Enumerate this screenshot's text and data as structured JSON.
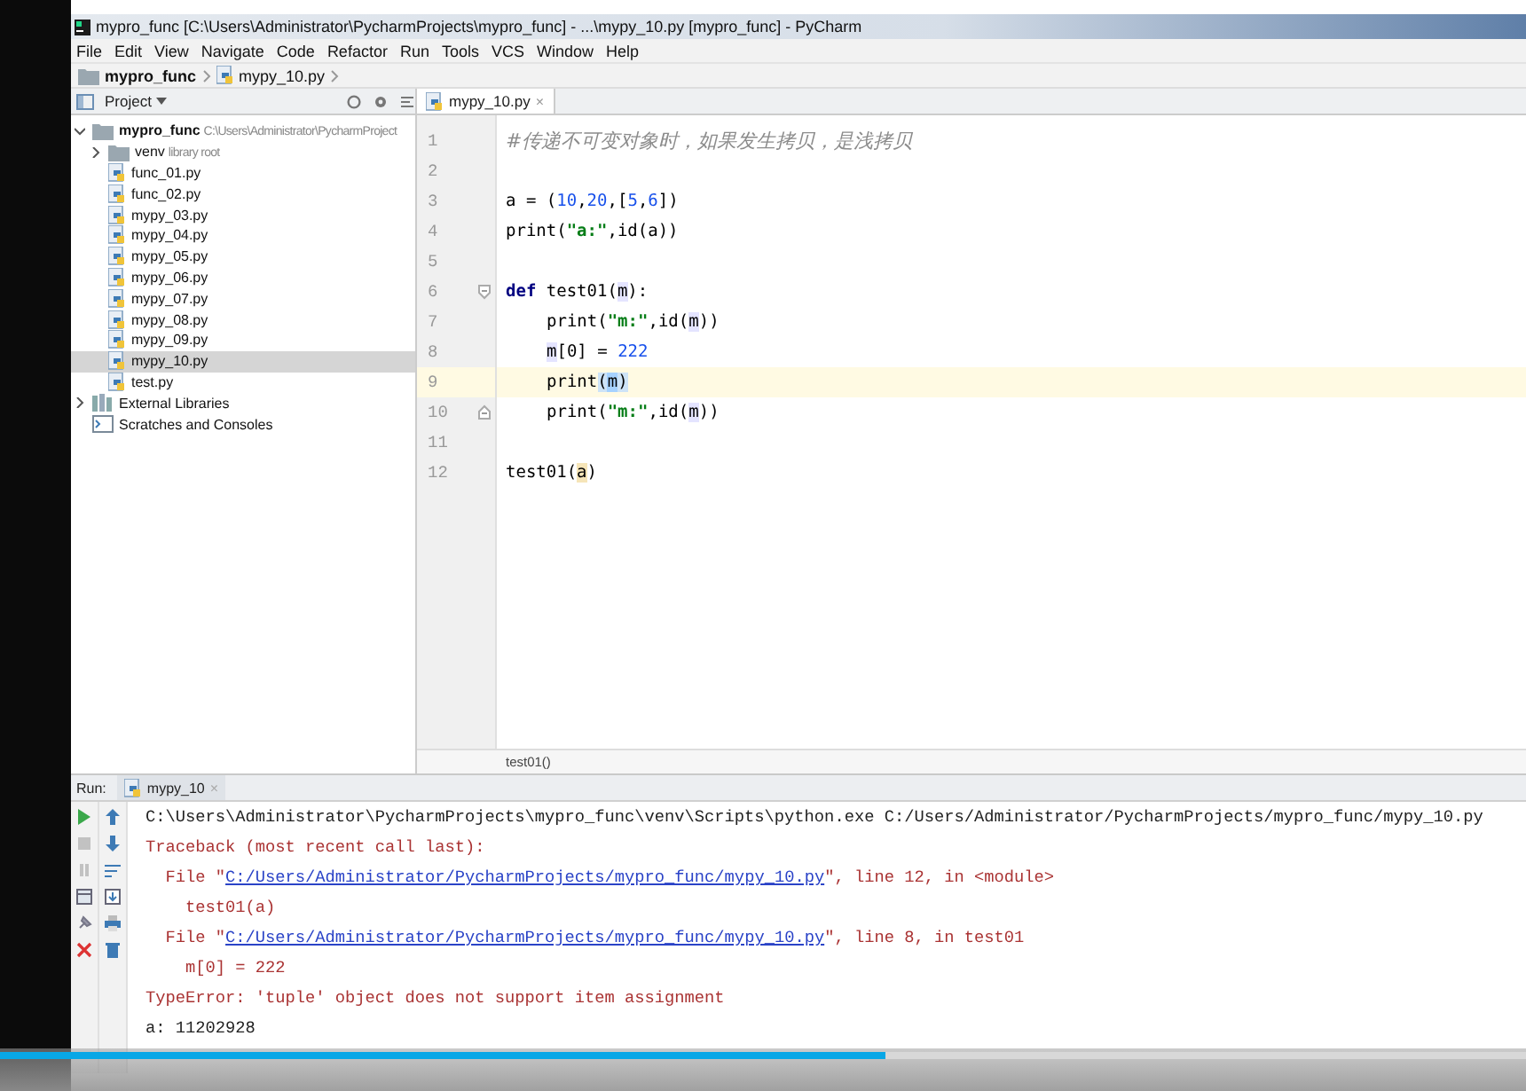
{
  "window": {
    "title": "mypro_func [C:\\Users\\Administrator\\PycharmProjects\\mypro_func] - ...\\mypy_10.py [mypro_func] - PyCharm"
  },
  "menu": [
    "File",
    "Edit",
    "View",
    "Navigate",
    "Code",
    "Refactor",
    "Run",
    "Tools",
    "VCS",
    "Window",
    "Help"
  ],
  "breadcrumb": [
    {
      "kind": "folder",
      "label": "mypro_func"
    },
    {
      "kind": "file",
      "label": "mypy_10.py"
    }
  ],
  "project_panel": {
    "title": "Project",
    "tree": [
      {
        "label": "mypro_func",
        "hint": "C:\\Users\\Administrator\\PycharmProject",
        "kind": "folder",
        "expanded": true,
        "selected": false,
        "children": [
          {
            "label": "venv",
            "hint": "library root",
            "kind": "folder",
            "expanded": false,
            "selected": false
          },
          {
            "label": "func_01.py",
            "kind": "file",
            "selected": false
          },
          {
            "label": "func_02.py",
            "kind": "file",
            "selected": false
          },
          {
            "label": "mypy_03.py",
            "kind": "file",
            "selected": false
          },
          {
            "label": "mypy_04.py",
            "kind": "file",
            "selected": false
          },
          {
            "label": "mypy_05.py",
            "kind": "file",
            "selected": false
          },
          {
            "label": "mypy_06.py",
            "kind": "file",
            "selected": false
          },
          {
            "label": "mypy_07.py",
            "kind": "file",
            "selected": false
          },
          {
            "label": "mypy_08.py",
            "kind": "file",
            "selected": false
          },
          {
            "label": "mypy_09.py",
            "kind": "file",
            "selected": false
          },
          {
            "label": "mypy_10.py",
            "kind": "file",
            "selected": true
          },
          {
            "label": "test.py",
            "kind": "file",
            "selected": false
          }
        ]
      },
      {
        "label": "External Libraries",
        "kind": "libraries",
        "expanded": false,
        "selected": false
      },
      {
        "label": "Scratches and Consoles",
        "kind": "scratches",
        "selected": false
      }
    ]
  },
  "editor": {
    "tab": {
      "label": "mypy_10.py",
      "close": "×",
      "selected": true
    },
    "lines": [
      {
        "number": "1",
        "current": false,
        "tokens": [
          {
            "t": "#传递不可变对象时，如果发生拷贝，是浅拷贝",
            "kind": "comment"
          }
        ]
      },
      {
        "number": "2",
        "current": false
      },
      {
        "number": "3",
        "current": false,
        "tokens": [
          {
            "t": "a = (",
            "kind": "plain"
          },
          {
            "t": "10",
            "kind": "number"
          },
          {
            "t": ",",
            "kind": "plain"
          },
          {
            "t": "20",
            "kind": "number"
          },
          {
            "t": ",[",
            "kind": "plain"
          },
          {
            "t": "5",
            "kind": "number"
          },
          {
            "t": ",",
            "kind": "plain"
          },
          {
            "t": "6",
            "kind": "number"
          },
          {
            "t": "])",
            "kind": "plain"
          }
        ]
      },
      {
        "number": "4",
        "current": false,
        "tokens": [
          {
            "t": "print(",
            "kind": "plain"
          },
          {
            "t": "\"a:\"",
            "kind": "string"
          },
          {
            "t": ",id(a))",
            "kind": "plain"
          }
        ]
      },
      {
        "number": "5",
        "current": false
      },
      {
        "number": "6",
        "current": false,
        "fold_start": true,
        "tokens": [
          {
            "t": "def",
            "kind": "keyword"
          },
          {
            "t": " test01(",
            "kind": "plain"
          },
          {
            "t": "m",
            "kind": "usage"
          },
          {
            "t": "):",
            "kind": "plain"
          }
        ]
      },
      {
        "number": "7",
        "current": false,
        "indented": true,
        "tokens": [
          {
            "t": "print(",
            "kind": "plain"
          },
          {
            "t": "\"m:\"",
            "kind": "string"
          },
          {
            "t": ",id(",
            "kind": "plain"
          },
          {
            "t": "m",
            "kind": "usage"
          },
          {
            "t": "))",
            "kind": "plain"
          }
        ]
      },
      {
        "number": "8",
        "current": false,
        "indented": true,
        "tokens": [
          {
            "t": "m",
            "kind": "usage"
          },
          {
            "t": "[0] = ",
            "kind": "plain"
          },
          {
            "t": "222",
            "kind": "number"
          }
        ]
      },
      {
        "number": "9",
        "current": true,
        "indented": true,
        "tokens": [
          {
            "t": "print",
            "kind": "plain"
          },
          {
            "t": "(",
            "kind": "brace"
          },
          {
            "t": "m",
            "kind": "selection"
          },
          {
            "t": ")",
            "kind": "brace"
          }
        ]
      },
      {
        "number": "10",
        "current": false,
        "indented": true,
        "fold_end": true,
        "tokens": [
          {
            "t": "print(",
            "kind": "plain"
          },
          {
            "t": "\"m:\"",
            "kind": "string"
          },
          {
            "t": ",id(",
            "kind": "plain"
          },
          {
            "t": "m",
            "kind": "usage"
          },
          {
            "t": "))",
            "kind": "plain"
          }
        ]
      },
      {
        "number": "11",
        "current": false
      },
      {
        "number": "12",
        "current": false,
        "tokens": [
          {
            "t": "test01(",
            "kind": "plain"
          },
          {
            "t": "a",
            "kind": "reference"
          },
          {
            "t": ")",
            "kind": "plain"
          }
        ]
      }
    ],
    "breadcrumb": "test01()"
  },
  "run_panel": {
    "label": "Run:",
    "tab": {
      "label": "mypy_10",
      "close": "×"
    },
    "output": [
      {
        "kind": "command",
        "text": "C:\\Users\\Administrator\\PycharmProjects\\mypro_func\\venv\\Scripts\\python.exe C:/Users/Administrator/PycharmProjects/mypro_func/mypy_10.py"
      },
      {
        "kind": "error",
        "text": "Traceback (most recent call last):"
      },
      {
        "kind": "frame",
        "before": "  File \"",
        "link": "C:/Users/Administrator/PycharmProjects/mypro_func/mypy_10.py",
        "after": "\", line 12, in <module>"
      },
      {
        "kind": "error",
        "text": "    test01(a)"
      },
      {
        "kind": "frame",
        "before": "  File \"",
        "link": "C:/Users/Administrator/PycharmProjects/mypro_func/mypy_10.py",
        "after": "\", line 8, in test01"
      },
      {
        "kind": "error",
        "text": "    m[0] = 222"
      },
      {
        "kind": "error",
        "text": "TypeError: 'tuple' object does not support item assignment"
      },
      {
        "kind": "command",
        "text": "a: 11202928"
      }
    ]
  },
  "video_player": {
    "level": 0.58
  }
}
